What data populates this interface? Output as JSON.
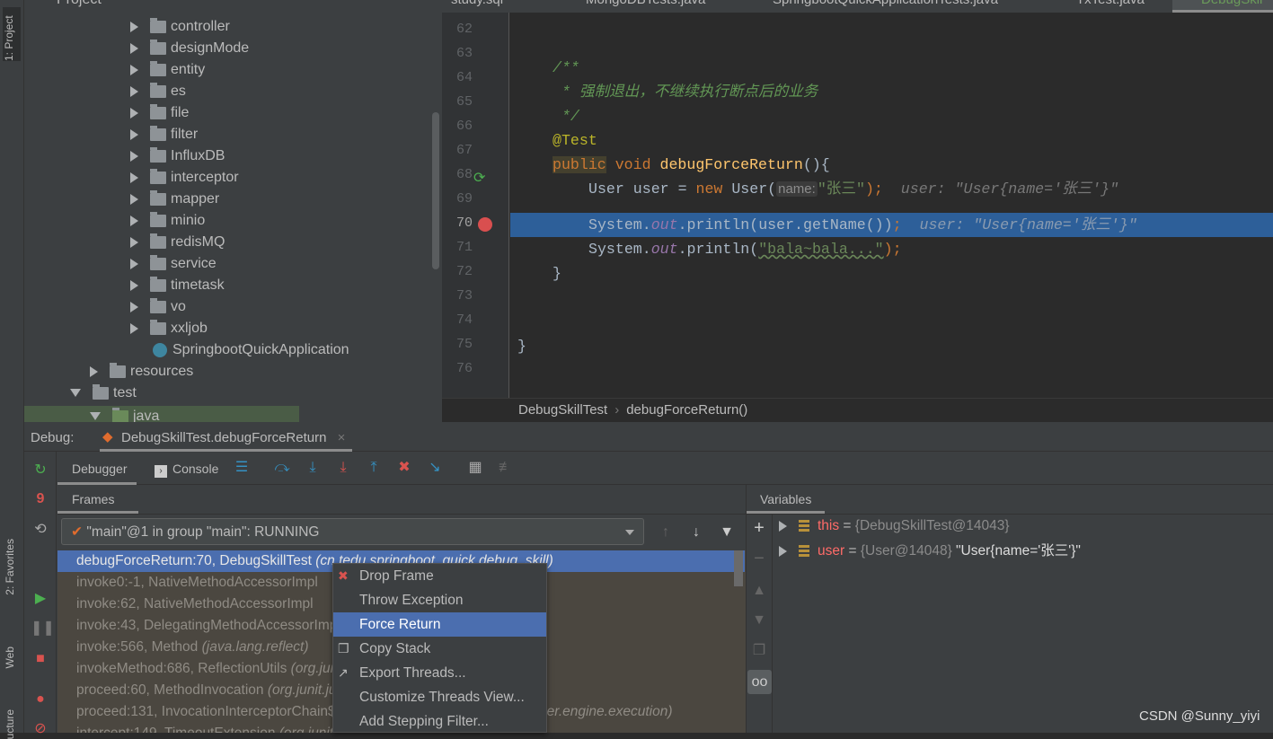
{
  "left_strip": {
    "project": "1: Project",
    "favorites": "2: Favorites",
    "web": "Web",
    "structure": "ucture"
  },
  "project_panel": {
    "title": "Project",
    "folders": [
      "controller",
      "designMode",
      "entity",
      "es",
      "file",
      "filter",
      "InfluxDB",
      "interceptor",
      "mapper",
      "minio",
      "redisMQ",
      "service",
      "timetask",
      "vo",
      "xxljob"
    ],
    "app_class": "SpringbootQuickApplication",
    "resources": "resources",
    "test": "test",
    "java": "java"
  },
  "editor_tabs": [
    "study.sql",
    "MongoDBTests.java",
    "SpringbootQuickApplicationTests.java",
    "TxTest.java",
    "DebugSkil"
  ],
  "editor": {
    "lines": [
      "62",
      "63",
      "64",
      "65",
      "66",
      "67",
      "68",
      "69",
      "70",
      "71",
      "72",
      "73",
      "74",
      "75",
      "76"
    ],
    "code": {
      "l64": "/**",
      "l65": " * 强制退出，不继续执行断点后的业务",
      "l66": " */",
      "l67": "@Test",
      "l68_kw1": "public",
      "l68_kw2": " void ",
      "l68_fn": "debugForceReturn",
      "l68_rest": "(){",
      "l69_a": "User user = ",
      "l69_new": "new",
      "l69_b": " User(",
      "l69_hint": "name:",
      "l69_str": "\"张三\"",
      "l69_c": ");",
      "l69_inline": "user: \"User{name='张三'}\"",
      "l70_a": "System.",
      "l70_out": "out",
      "l70_b": ".println(user.getName())",
      "l70_c": ";",
      "l70_inline": "user: \"User{name='张三'}\"",
      "l71_a": "System.",
      "l71_out": "out",
      "l71_b": ".println(",
      "l71_str": "\"bala~bala...\"",
      "l71_c": ");",
      "l72": "}",
      "l75": "}"
    },
    "current_line": "70"
  },
  "breadcrumb": [
    "DebugSkillTest",
    "debugForceReturn()"
  ],
  "debug": {
    "label": "Debug:",
    "session": "DebugSkillTest.debugForceReturn",
    "tabs": {
      "debugger": "Debugger",
      "console": "Console"
    },
    "frames_title": "Frames",
    "variables_title": "Variables",
    "thread": "\"main\"@1 in group \"main\": RUNNING",
    "frames": [
      {
        "m": "debugForceReturn:70, DebugSkillTest ",
        "p": "(cn.tedu.springboot_quick.debug_skill)"
      },
      {
        "m": "invoke0:-1, NativeMethodAccessorImpl",
        "p": ""
      },
      {
        "m": "invoke:62, NativeMethodAccessorImpl",
        "p": ""
      },
      {
        "m": "invoke:43, DelegatingMethodAccessorImpl",
        "p": ""
      },
      {
        "m": "invoke:566, Method ",
        "p": "(java.lang.reflect)"
      },
      {
        "m": "invokeMethod:686, ReflectionUtils ",
        "p": "(org.junit.platform.commons.util)"
      },
      {
        "m": "proceed:60, MethodInvocation ",
        "p": "(org.junit.jupiter.engine.execution)"
      },
      {
        "m": "proceed:131, InvocationInterceptorChain$ValidatingInvocation ",
        "p": "(org.junit.jupiter.engine.execution)"
      },
      {
        "m": "intercept:149, TimeoutExtension ",
        "p": "(org.junit.jupiter.engine.extension)"
      }
    ],
    "variables": [
      {
        "name": "this",
        "value": "{DebugSkillTest@14043}",
        "extra": ""
      },
      {
        "name": "user",
        "value": "{User@14048}",
        "extra": " \"User{name='张三'}\""
      }
    ]
  },
  "context_menu": {
    "items": [
      "Drop Frame",
      "Throw Exception",
      "Force Return",
      "Copy Stack",
      "Export Threads...",
      "Customize Threads View...",
      "Add Stepping Filter..."
    ],
    "selected": "Force Return"
  },
  "watermark": "CSDN @Sunny_yiyi",
  "colors": {
    "selection": "#2f65ca",
    "menu_highlight": "#4b6eaf",
    "keyword": "#cc7832",
    "string": "#6a8759"
  }
}
